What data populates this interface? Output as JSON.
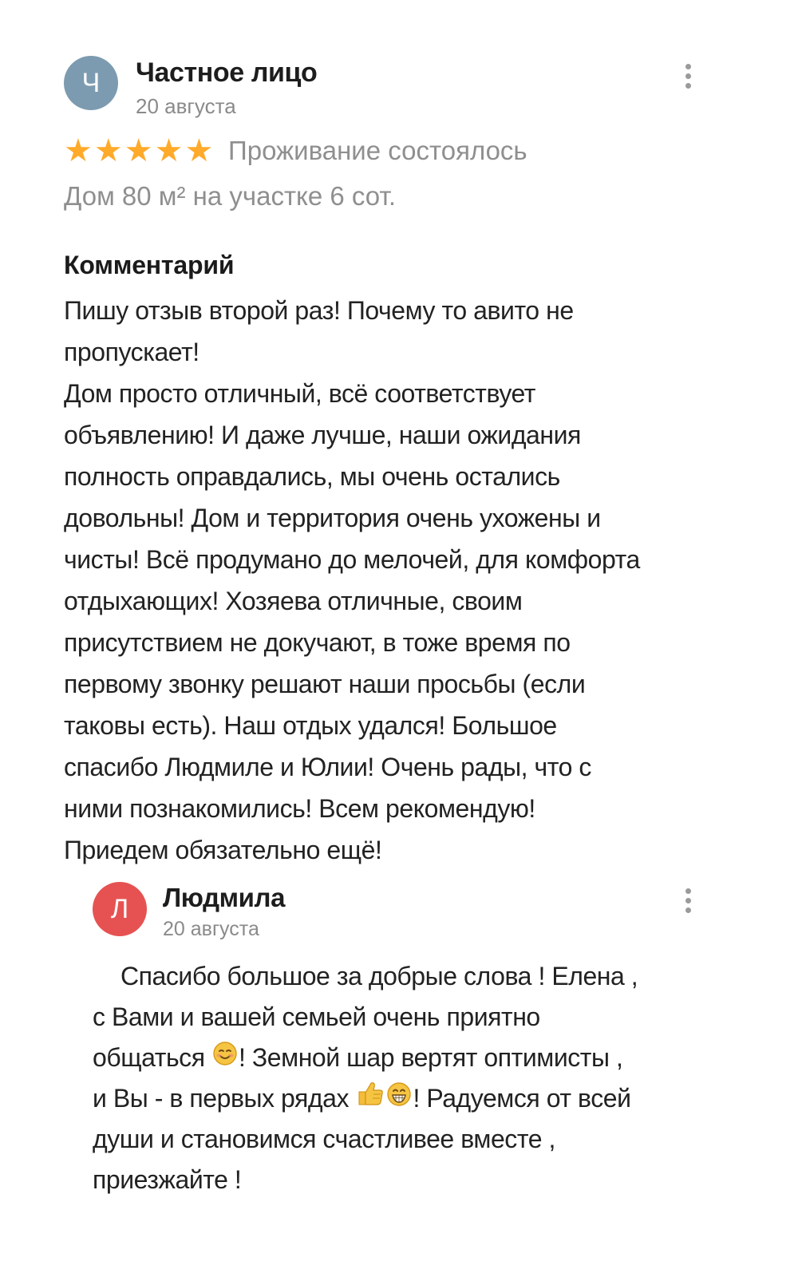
{
  "review": {
    "avatar_letter": "Ч",
    "author": "Частное лицо",
    "date": "20 августа",
    "rating": 5,
    "stars": "★★★★★",
    "stay_status": "Проживание состоялось",
    "listing": "Дом 80 м² на участке 6 сот.",
    "comment_heading": "Комментарий",
    "comment_lines": [
      "Пишу отзыв второй раз! Почему то авито не",
      "пропускает!",
      "Дом просто отличный, всё соответствует",
      "объявлению! И даже лучше, наши ожидания",
      "полность оправдались, мы очень остались",
      "довольны! Дом и территория очень ухожены и",
      "чисты! Всё продумано до мелочей, для комфорта",
      "отдыхающих! Хозяева отличные, своим",
      "присутствием не докучают, в тоже время по",
      "первому звонку решают наши просьбы (если",
      "таковы есть). Наш отдых удался! Большое",
      "спасибо Людмиле и Юлии! Очень рады, что с",
      "ними познакомились! Всем рекомендую!",
      "Приедем обязательно ещё!"
    ],
    "colors": {
      "avatar": "#7d9bb0",
      "stars": "#ffaa2a",
      "muted_text": "#8f8f8f"
    }
  },
  "reply": {
    "avatar_letter": "Л",
    "author": "Людмила",
    "date": "20 августа",
    "lines": {
      "line1": "Спасибо большое за добрые слова ! Елена ,",
      "line2": "с Вами и вашей семьей очень приятно",
      "line3_before_emoji": "общаться ",
      "line3_after_emoji": "! Земной шар вертят оптимисты ,",
      "line4_before_emoji": "и Вы - в первых рядах ",
      "line4_after_emoji": "! Радуемся от всей",
      "line5": "души и становимся счастливее вместе ,",
      "line6": "приезжайте !"
    },
    "emoji_icons": [
      "smiling-blushing-emoji-icon",
      "thumbs-up-emoji-icon",
      "grinning-emoji-icon"
    ],
    "colors": {
      "avatar": "#e65252"
    }
  },
  "icons": [
    "more-vertical-icon",
    "star-icon"
  ]
}
